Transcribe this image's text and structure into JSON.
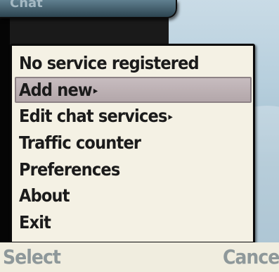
{
  "title_bar": {
    "title": "Chat"
  },
  "menu": {
    "items": [
      {
        "label": "No service registered",
        "submenu": false,
        "selected": false
      },
      {
        "label": "Add new",
        "submenu": true,
        "selected": true
      },
      {
        "label": "Edit chat services",
        "submenu": true,
        "selected": false
      },
      {
        "label": "Traffic counter",
        "submenu": false,
        "selected": false
      },
      {
        "label": "Preferences",
        "submenu": false,
        "selected": false
      },
      {
        "label": "About",
        "submenu": false,
        "selected": false
      },
      {
        "label": "Exit",
        "submenu": false,
        "selected": false
      }
    ],
    "submenu_arrow": "▸"
  },
  "softkeys": {
    "left": "Select",
    "right": "Cancel"
  },
  "colors": {
    "popup_bg": "#f4f1e4",
    "selection_bg": "#b8adb0",
    "softkey_text": "#8e989a",
    "menu_text": "#1b1b1b"
  }
}
